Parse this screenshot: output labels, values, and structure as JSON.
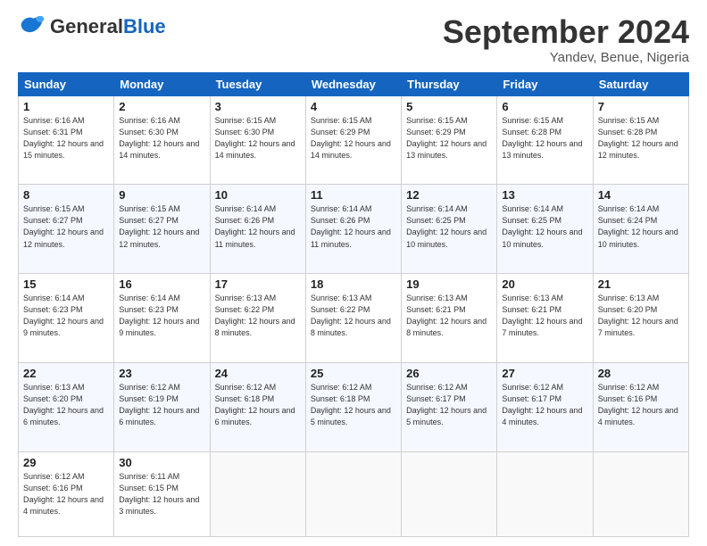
{
  "header": {
    "logo_general": "General",
    "logo_blue": "Blue",
    "month_title": "September 2024",
    "location": "Yandev, Benue, Nigeria"
  },
  "weekdays": [
    "Sunday",
    "Monday",
    "Tuesday",
    "Wednesday",
    "Thursday",
    "Friday",
    "Saturday"
  ],
  "weeks": [
    [
      {
        "day": "1",
        "sunrise": "6:16 AM",
        "sunset": "6:31 PM",
        "daylight": "12 hours and 15 minutes."
      },
      {
        "day": "2",
        "sunrise": "6:16 AM",
        "sunset": "6:30 PM",
        "daylight": "12 hours and 14 minutes."
      },
      {
        "day": "3",
        "sunrise": "6:15 AM",
        "sunset": "6:30 PM",
        "daylight": "12 hours and 14 minutes."
      },
      {
        "day": "4",
        "sunrise": "6:15 AM",
        "sunset": "6:29 PM",
        "daylight": "12 hours and 14 minutes."
      },
      {
        "day": "5",
        "sunrise": "6:15 AM",
        "sunset": "6:29 PM",
        "daylight": "12 hours and 13 minutes."
      },
      {
        "day": "6",
        "sunrise": "6:15 AM",
        "sunset": "6:28 PM",
        "daylight": "12 hours and 13 minutes."
      },
      {
        "day": "7",
        "sunrise": "6:15 AM",
        "sunset": "6:28 PM",
        "daylight": "12 hours and 12 minutes."
      }
    ],
    [
      {
        "day": "8",
        "sunrise": "6:15 AM",
        "sunset": "6:27 PM",
        "daylight": "12 hours and 12 minutes."
      },
      {
        "day": "9",
        "sunrise": "6:15 AM",
        "sunset": "6:27 PM",
        "daylight": "12 hours and 12 minutes."
      },
      {
        "day": "10",
        "sunrise": "6:14 AM",
        "sunset": "6:26 PM",
        "daylight": "12 hours and 11 minutes."
      },
      {
        "day": "11",
        "sunrise": "6:14 AM",
        "sunset": "6:26 PM",
        "daylight": "12 hours and 11 minutes."
      },
      {
        "day": "12",
        "sunrise": "6:14 AM",
        "sunset": "6:25 PM",
        "daylight": "12 hours and 10 minutes."
      },
      {
        "day": "13",
        "sunrise": "6:14 AM",
        "sunset": "6:25 PM",
        "daylight": "12 hours and 10 minutes."
      },
      {
        "day": "14",
        "sunrise": "6:14 AM",
        "sunset": "6:24 PM",
        "daylight": "12 hours and 10 minutes."
      }
    ],
    [
      {
        "day": "15",
        "sunrise": "6:14 AM",
        "sunset": "6:23 PM",
        "daylight": "12 hours and 9 minutes."
      },
      {
        "day": "16",
        "sunrise": "6:14 AM",
        "sunset": "6:23 PM",
        "daylight": "12 hours and 9 minutes."
      },
      {
        "day": "17",
        "sunrise": "6:13 AM",
        "sunset": "6:22 PM",
        "daylight": "12 hours and 8 minutes."
      },
      {
        "day": "18",
        "sunrise": "6:13 AM",
        "sunset": "6:22 PM",
        "daylight": "12 hours and 8 minutes."
      },
      {
        "day": "19",
        "sunrise": "6:13 AM",
        "sunset": "6:21 PM",
        "daylight": "12 hours and 8 minutes."
      },
      {
        "day": "20",
        "sunrise": "6:13 AM",
        "sunset": "6:21 PM",
        "daylight": "12 hours and 7 minutes."
      },
      {
        "day": "21",
        "sunrise": "6:13 AM",
        "sunset": "6:20 PM",
        "daylight": "12 hours and 7 minutes."
      }
    ],
    [
      {
        "day": "22",
        "sunrise": "6:13 AM",
        "sunset": "6:20 PM",
        "daylight": "12 hours and 6 minutes."
      },
      {
        "day": "23",
        "sunrise": "6:12 AM",
        "sunset": "6:19 PM",
        "daylight": "12 hours and 6 minutes."
      },
      {
        "day": "24",
        "sunrise": "6:12 AM",
        "sunset": "6:18 PM",
        "daylight": "12 hours and 6 minutes."
      },
      {
        "day": "25",
        "sunrise": "6:12 AM",
        "sunset": "6:18 PM",
        "daylight": "12 hours and 5 minutes."
      },
      {
        "day": "26",
        "sunrise": "6:12 AM",
        "sunset": "6:17 PM",
        "daylight": "12 hours and 5 minutes."
      },
      {
        "day": "27",
        "sunrise": "6:12 AM",
        "sunset": "6:17 PM",
        "daylight": "12 hours and 4 minutes."
      },
      {
        "day": "28",
        "sunrise": "6:12 AM",
        "sunset": "6:16 PM",
        "daylight": "12 hours and 4 minutes."
      }
    ],
    [
      {
        "day": "29",
        "sunrise": "6:12 AM",
        "sunset": "6:16 PM",
        "daylight": "12 hours and 4 minutes."
      },
      {
        "day": "30",
        "sunrise": "6:11 AM",
        "sunset": "6:15 PM",
        "daylight": "12 hours and 3 minutes."
      },
      null,
      null,
      null,
      null,
      null
    ]
  ]
}
